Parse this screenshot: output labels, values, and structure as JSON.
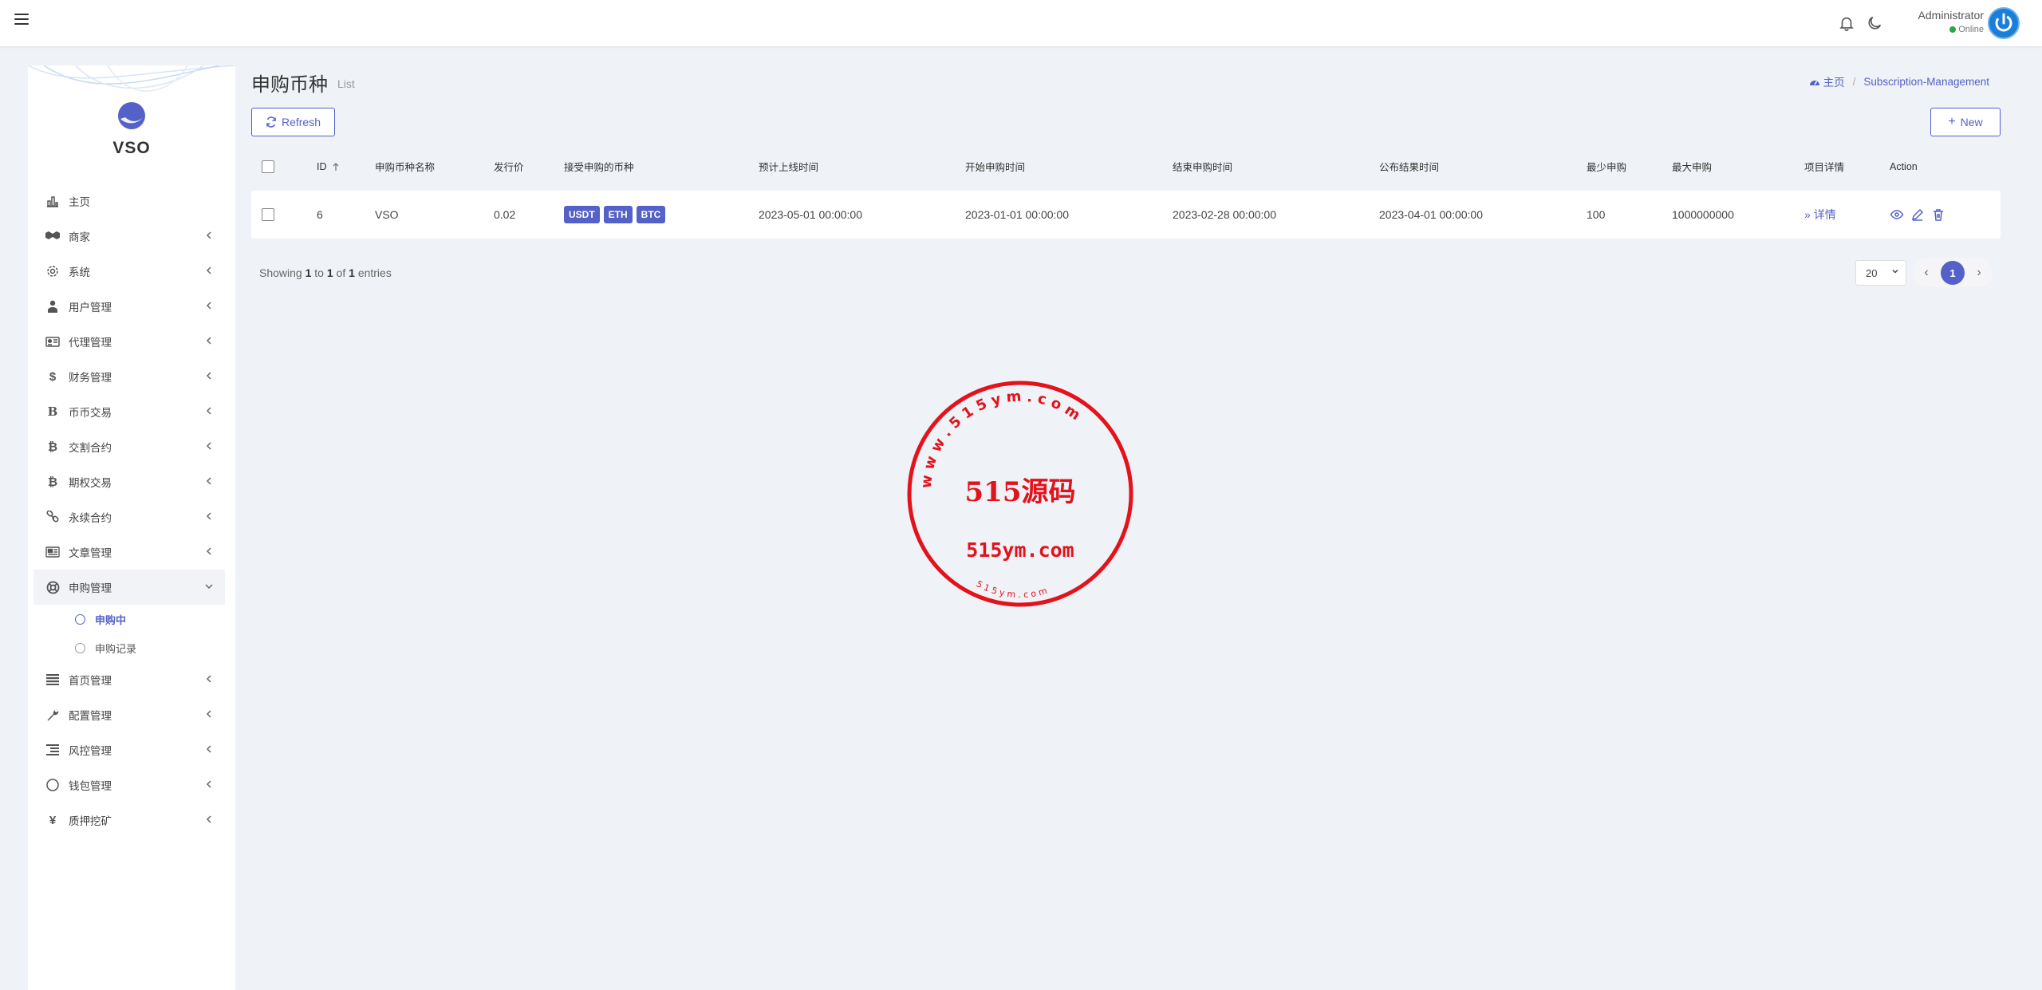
{
  "navbar": {
    "user_name": "Administrator",
    "user_status": "Online",
    "icons": [
      "menu-icon",
      "bell-icon",
      "moon-icon",
      "power-icon"
    ]
  },
  "sidebar": {
    "brand": "VSO",
    "menu": [
      {
        "label": "主页",
        "icon": "chart-icon"
      },
      {
        "label": "商家",
        "icon": "handshake-icon"
      },
      {
        "label": "系统",
        "icon": "gear-icon"
      },
      {
        "label": "用户管理",
        "icon": "user-tie-icon"
      },
      {
        "label": "代理管理",
        "icon": "id-card-icon"
      },
      {
        "label": "财务管理",
        "icon": "dollar-icon"
      },
      {
        "label": "币币交易",
        "icon": "b-icon"
      },
      {
        "label": "交割合约",
        "icon": "bitcoin-icon"
      },
      {
        "label": "期权交易",
        "icon": "bitcoin-icon"
      },
      {
        "label": "永续合约",
        "icon": "link-icon"
      },
      {
        "label": "文章管理",
        "icon": "newspaper-icon"
      },
      {
        "label": "申购管理",
        "icon": "lifebuoy-icon"
      }
    ],
    "submenu": [
      {
        "label": "申购中"
      },
      {
        "label": "申购记录"
      }
    ],
    "menu_after": [
      {
        "label": "首页管理",
        "icon": "list-icon"
      },
      {
        "label": "配置管理",
        "icon": "wrench-icon"
      },
      {
        "label": "风控管理",
        "icon": "align-icon"
      },
      {
        "label": "钱包管理",
        "icon": "circle-icon"
      },
      {
        "label": "质押挖矿",
        "icon": "yen-icon"
      }
    ]
  },
  "page": {
    "title": "申购币种",
    "subtitle": "List",
    "breadcrumb_home": "主页",
    "breadcrumb_current": "Subscription-Management",
    "refresh_label": "Refresh",
    "new_label": "New"
  },
  "table": {
    "headers": [
      "ID",
      "申购币种名称",
      "发行价",
      "接受申购的币种",
      "预计上线时间",
      "开始申购时间",
      "结束申购时间",
      "公布结果时间",
      "最少申购",
      "最大申购",
      "项目详情",
      "Action"
    ],
    "rows": [
      {
        "id": "6",
        "name": "VSO",
        "price": "0.02",
        "coins": [
          "USDT",
          "ETH",
          "BTC"
        ],
        "online_time": "2023-05-01 00:00:00",
        "start_time": "2023-01-01 00:00:00",
        "end_time": "2023-02-28 00:00:00",
        "publish_time": "2023-04-01 00:00:00",
        "min": "100",
        "max": "1000000000",
        "detail": "详情"
      }
    ]
  },
  "footer": {
    "showing": "Showing",
    "from": "1",
    "to_word": "to",
    "to": "1",
    "of_word": "of",
    "total": "1",
    "entries": "entries",
    "page_size": "20",
    "current_page": "1"
  },
  "watermark": {
    "main": "515源码",
    "domain": "515ym.com",
    "ring_top": "w w w . 5 1 5 y m . c o m",
    "ring_bottom": "5 1 5 y m . c o m"
  }
}
